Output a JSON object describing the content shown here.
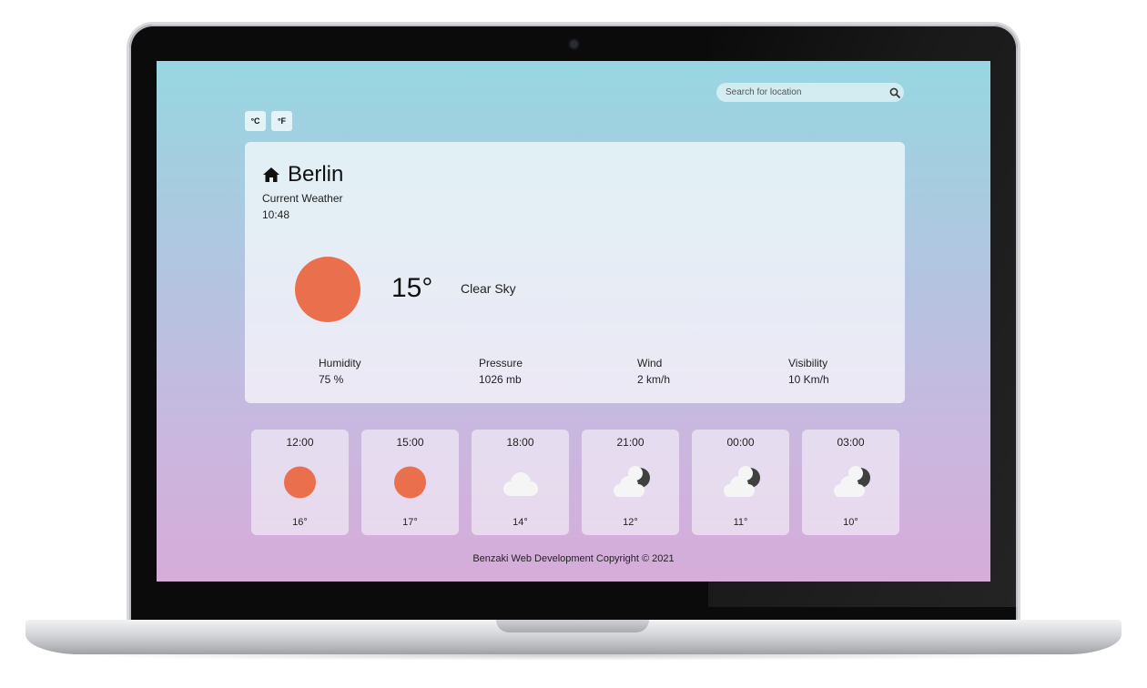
{
  "search": {
    "placeholder": "Search for location",
    "icon": "search-icon"
  },
  "units": [
    "°C",
    "°F"
  ],
  "current": {
    "city": "Berlin",
    "label": "Current Weather",
    "time": "10:48",
    "temperature": "15°",
    "condition": "Clear Sky",
    "icon": "sun-icon",
    "stats": [
      {
        "label": "Humidity",
        "value": "75 %"
      },
      {
        "label": "Pressure",
        "value": "1026 mb"
      },
      {
        "label": "Wind",
        "value": "2 km/h"
      },
      {
        "label": "Visibility",
        "value": "10 Km/h"
      }
    ]
  },
  "forecast": [
    {
      "time": "12:00",
      "temp": "16°",
      "icon": "sun-icon"
    },
    {
      "time": "15:00",
      "temp": "17°",
      "icon": "sun-icon"
    },
    {
      "time": "18:00",
      "temp": "14°",
      "icon": "cloud-icon"
    },
    {
      "time": "21:00",
      "temp": "12°",
      "icon": "cloud-moon-icon"
    },
    {
      "time": "00:00",
      "temp": "11°",
      "icon": "cloud-moon-icon"
    },
    {
      "time": "03:00",
      "temp": "10°",
      "icon": "cloud-moon-icon"
    }
  ],
  "footer": "Benzaki Web Development Copyright © 2021",
  "colors": {
    "sun": "#ea6f4d",
    "moon": "#404040",
    "cloud": "#f5f5f5"
  }
}
